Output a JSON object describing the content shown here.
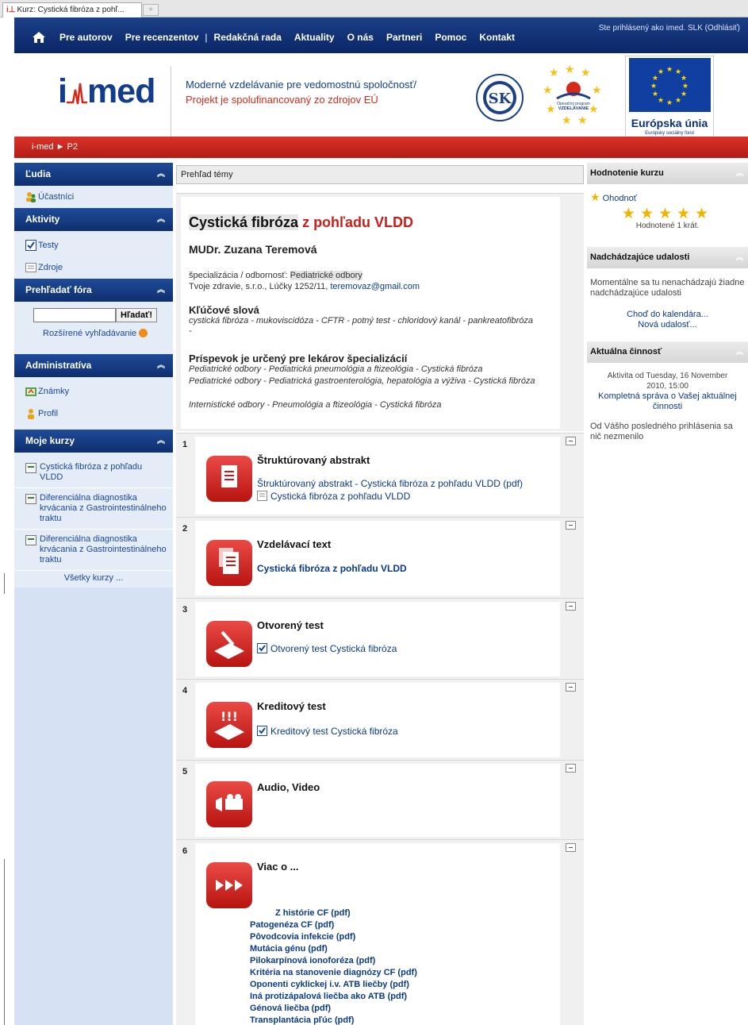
{
  "browser": {
    "tab_title": "Kurz: Cystická fibróza z pohľ..."
  },
  "nav": {
    "items": [
      "Pre autorov",
      "Pre recenzentov",
      "|",
      "Redakčná rada",
      "Aktuality",
      "O nás",
      "Partneri",
      "Pomoc",
      "Kontakt"
    ],
    "login_text": "Ste prihlásený ako imed. SLK (Odhlásiť)"
  },
  "banner": {
    "logo_i": "i",
    "logo_med": "med",
    "tagline1": "Moderné vzdelávanie pre vedomostnú spoločnosť/",
    "tagline2": "Projekt je spolufinancovaný zo zdrojov EÚ",
    "eu_title": "Európska únia",
    "eu_sub": "Európsky sociálny fond"
  },
  "breadcrumb": {
    "root": "i-med",
    "sep": "►",
    "current": "P2"
  },
  "left": {
    "people": {
      "title": "Ľudia",
      "participants": "Účastníci"
    },
    "activities": {
      "title": "Aktivity",
      "tests": "Testy",
      "resources": "Zdroje"
    },
    "forum_search": {
      "title": "Prehľadať fóra",
      "button": "Hľadať!",
      "advanced": "Rozšírené vyhľadávanie"
    },
    "admin": {
      "title": "Administratíva",
      "grades": "Známky",
      "profile": "Profil"
    },
    "my_courses": {
      "title": "Moje kurzy",
      "courses": [
        "Cystická fibróza z pohľadu VLDD",
        "Diferenciálna diagnostika krvácania z Gastrointestinálneho traktu",
        "Diferenciálna diagnostika krvácania z Gastrointestinálneho traktu"
      ],
      "all": "Všetky kurzy ..."
    }
  },
  "main": {
    "overview_title": "Prehľad témy",
    "course_title_a": "Cystická fibróza",
    "course_title_b": " z pohľadu VLDD",
    "author": "MUDr. Zuzana Teremová",
    "spec_label": "špecializácia / odbornosť:",
    "spec_value": "Pediatrické odbory",
    "address": "Tvoje zdravie, s.r.o., Lúčky 1252/11,",
    "email": "teremovaz@gmail.com",
    "keywords_title": "Kľúčové slová",
    "keywords": "cystická fibróza - mukoviscidóza - CFTR - potný test - chloridový kanál - pankreatofibróza -",
    "intended_title": "Príspevok je určený pre lekárov špecializácií",
    "intended": [
      "Pediatrické odbory - Pediatrická pneumológia a ftizeológia - Cystická fibróza",
      "Pediatrické odbory - Pediatrická gastroenterológia, hepatológia a výživa - Cystická fibróza",
      "Internistické odbory - Pneumológia a ftizeológia - Cystická fibróza"
    ],
    "sections": [
      {
        "num": "1",
        "title": "Štruktúrovaný abstrakt",
        "link": "Štruktúrovaný abstrakt - Cystická fibróza z pohľadu VLDD (pdf)",
        "sublink": "Cystická fibróza z pohľadu VLDD"
      },
      {
        "num": "2",
        "title": "Vzdelávací text",
        "link": "Cystická fibróza z pohľadu VLDD"
      },
      {
        "num": "3",
        "title": "Otvorený test",
        "link": "Otvorený test Cystická fibróza"
      },
      {
        "num": "4",
        "title": "Kreditový test",
        "link": "Kreditový test Cystická fibróza"
      },
      {
        "num": "5",
        "title": "Audio, Video"
      },
      {
        "num": "6",
        "title": "Viac o ...",
        "links": [
          "Z histórie CF (pdf)",
          "Patogenéza CF (pdf)",
          "Pôvodcovia infekcie (pdf)",
          "Mutácia génu (pdf)",
          "Pilokarpínová ionoforéza (pdf)",
          "Kritéria na stanovenie diagnózy CF (pdf)",
          "Oponenti cyklickej i.v. ATB liečby (pdf)",
          "Iná protizápalová liečba ako ATB (pdf)",
          "Génová liečba (pdf)",
          "Transplantácia pľúc (pdf)"
        ]
      }
    ]
  },
  "right": {
    "rating": {
      "title": "Hodnotenie kurzu",
      "rate": "Ohodnoť",
      "rating_value": 5,
      "stars": "★★★★★",
      "count": "Hodnotené 1 krát."
    },
    "events": {
      "title": "Nadchádzajúce udalosti",
      "text": "Momentálne sa tu nenachádzajú žiadne nadchádzajúce udalosti",
      "calendar": "Choď do kalendára...",
      "new": "Nová udalosť..."
    },
    "activity": {
      "title": "Aktuálna činnosť",
      "since": "Aktivita od Tuesday, 16 November 2010, 15:00",
      "report": "Kompletná správa o Vašej aktuálnej činnosti",
      "nothing": "Od Vášho posledného prihlásenia sa nič nezmenilo"
    }
  }
}
